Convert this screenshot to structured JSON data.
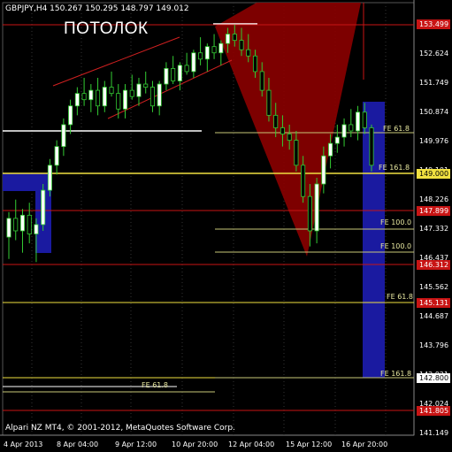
{
  "header": {
    "symbol_info": "GBPJPY,H4  150.267 150.295 148.797 149.012",
    "watermark": "ПОТОЛОК",
    "copyright": "Alpari NZ MT4, © 2001-2012, MetaQuotes Software Corp."
  },
  "price_axis": {
    "ticks": [
      "152.624",
      "151.749",
      "150.874",
      "149.976",
      "149.101",
      "148.226",
      "147.332",
      "146.437",
      "145.562",
      "144.687",
      "143.796",
      "142.921",
      "142.024",
      "141.149"
    ],
    "levels": [
      {
        "value": "153.499",
        "style": "red"
      },
      {
        "value": "149.000",
        "style": "yellow"
      },
      {
        "value": "147.899",
        "style": "red"
      },
      {
        "value": "146.312",
        "style": "red"
      },
      {
        "value": "145.131",
        "style": "red"
      },
      {
        "value": "142.800",
        "style": "white"
      },
      {
        "value": "141.805",
        "style": "red"
      }
    ]
  },
  "time_axis": {
    "labels": [
      "4 Apr 2013",
      "8 Apr 04:00",
      "9 Apr 12:00",
      "10 Apr 20:00",
      "12 Apr 04:00",
      "15 Apr 12:00",
      "16 Apr 20:00"
    ]
  },
  "fib_labels": [
    "FE 61.8",
    "FE 161.8",
    "FE 100.0",
    "FE 100.0",
    "FE 61.8",
    "FE 161.8",
    "FE 61.8"
  ],
  "colors": {
    "background": "#000000",
    "bull_candle": "#ffffff",
    "bear_candle": "#000000",
    "wick": "#33cc33",
    "level_red": "#c81414",
    "fib_yellow": "#e8e8a0",
    "zone_blue": "#1a1aa0",
    "triangle_red": "#8b0000"
  },
  "chart_data": {
    "type": "candlestick",
    "symbol": "GBPJPY",
    "timeframe": "H4",
    "ohlc_header": {
      "open": 150.267,
      "high": 150.295,
      "low": 148.797,
      "close": 149.012
    },
    "ylim": [
      141.149,
      153.499
    ],
    "candles": [
      [
        146.7,
        147.5,
        146.0,
        147.3
      ],
      [
        147.3,
        147.9,
        146.6,
        146.9
      ],
      [
        146.9,
        147.6,
        146.2,
        147.4
      ],
      [
        147.4,
        147.8,
        146.5,
        146.8
      ],
      [
        146.8,
        147.3,
        145.9,
        147.1
      ],
      [
        147.1,
        148.4,
        146.9,
        148.2
      ],
      [
        148.2,
        149.2,
        148.0,
        149.0
      ],
      [
        149.0,
        149.8,
        148.7,
        149.6
      ],
      [
        149.6,
        150.5,
        149.3,
        150.3
      ],
      [
        150.3,
        151.1,
        150.0,
        150.9
      ],
      [
        150.9,
        151.5,
        150.6,
        151.3
      ],
      [
        151.3,
        151.8,
        150.9,
        151.1
      ],
      [
        151.1,
        151.6,
        150.7,
        151.4
      ],
      [
        151.4,
        151.8,
        150.6,
        150.9
      ],
      [
        150.9,
        151.7,
        150.7,
        151.5
      ],
      [
        151.5,
        152.0,
        151.2,
        151.3
      ],
      [
        151.3,
        151.6,
        150.5,
        150.8
      ],
      [
        150.8,
        151.6,
        150.5,
        151.4
      ],
      [
        151.4,
        151.9,
        151.1,
        151.2
      ],
      [
        151.2,
        151.8,
        150.9,
        151.6
      ],
      [
        151.6,
        152.0,
        151.3,
        151.5
      ],
      [
        151.5,
        151.7,
        150.7,
        150.9
      ],
      [
        150.9,
        151.7,
        150.6,
        151.6
      ],
      [
        151.6,
        152.3,
        151.4,
        152.1
      ],
      [
        152.1,
        152.5,
        151.6,
        151.7
      ],
      [
        151.7,
        152.3,
        151.4,
        152.2
      ],
      [
        152.2,
        152.6,
        151.9,
        152.0
      ],
      [
        152.0,
        152.7,
        151.8,
        152.6
      ],
      [
        152.6,
        153.1,
        152.2,
        152.4
      ],
      [
        152.4,
        152.9,
        152.0,
        152.8
      ],
      [
        152.8,
        153.2,
        152.4,
        152.6
      ],
      [
        152.6,
        153.0,
        152.2,
        152.9
      ],
      [
        152.9,
        153.4,
        152.6,
        153.2
      ],
      [
        153.2,
        153.5,
        152.8,
        153.0
      ],
      [
        153.0,
        153.4,
        152.5,
        152.7
      ],
      [
        152.7,
        153.2,
        152.3,
        152.5
      ],
      [
        152.5,
        152.7,
        151.8,
        152.0
      ],
      [
        152.0,
        152.3,
        151.2,
        151.4
      ],
      [
        151.4,
        151.8,
        150.4,
        150.6
      ],
      [
        150.6,
        151.0,
        149.9,
        150.2
      ],
      [
        150.2,
        150.6,
        149.6,
        150.0
      ],
      [
        150.0,
        150.3,
        149.5,
        149.8
      ],
      [
        149.8,
        150.1,
        148.8,
        149.0
      ],
      [
        149.0,
        149.3,
        147.8,
        148.0
      ],
      [
        148.0,
        148.4,
        146.4,
        146.9
      ],
      [
        146.9,
        148.6,
        146.5,
        148.4
      ],
      [
        148.4,
        149.6,
        148.1,
        149.3
      ],
      [
        149.3,
        150.0,
        148.9,
        149.7
      ],
      [
        149.7,
        150.3,
        149.4,
        149.9
      ],
      [
        149.9,
        150.5,
        149.6,
        150.3
      ],
      [
        150.3,
        150.8,
        149.9,
        150.1
      ],
      [
        150.1,
        150.9,
        149.8,
        150.7
      ],
      [
        150.7,
        151.0,
        150.0,
        150.2
      ],
      [
        150.2,
        150.3,
        148.8,
        149.0
      ]
    ]
  }
}
